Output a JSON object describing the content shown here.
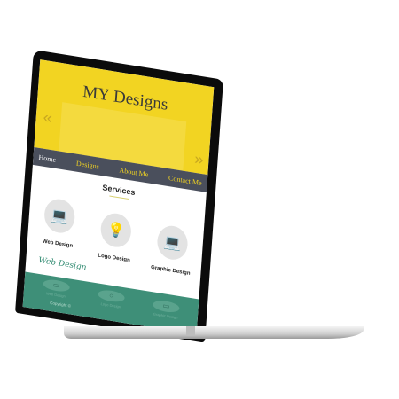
{
  "site": {
    "title": "MY Designs",
    "prev_icon": "«",
    "next_icon": "»",
    "nav": [
      "Home",
      "Designs",
      "About Me",
      "Contact Me"
    ],
    "services_heading": "Services",
    "services": [
      {
        "label": "Web Design",
        "icon": "laptop-icon",
        "glyph": "💻"
      },
      {
        "label": "Logo Design",
        "icon": "lightbulb-icon",
        "glyph": "💡"
      },
      {
        "label": "Graphic Design",
        "icon": "laptop-icon",
        "glyph": "💻"
      }
    ],
    "script_text": "Web Design",
    "footer_items": [
      "Web Design",
      "Logo Design",
      "Graphic Design"
    ],
    "copyright": "Copyright ©"
  },
  "colors": {
    "yellow": "#f2d422",
    "nav": "#4a4f5c",
    "footer": "#3e8f78"
  }
}
